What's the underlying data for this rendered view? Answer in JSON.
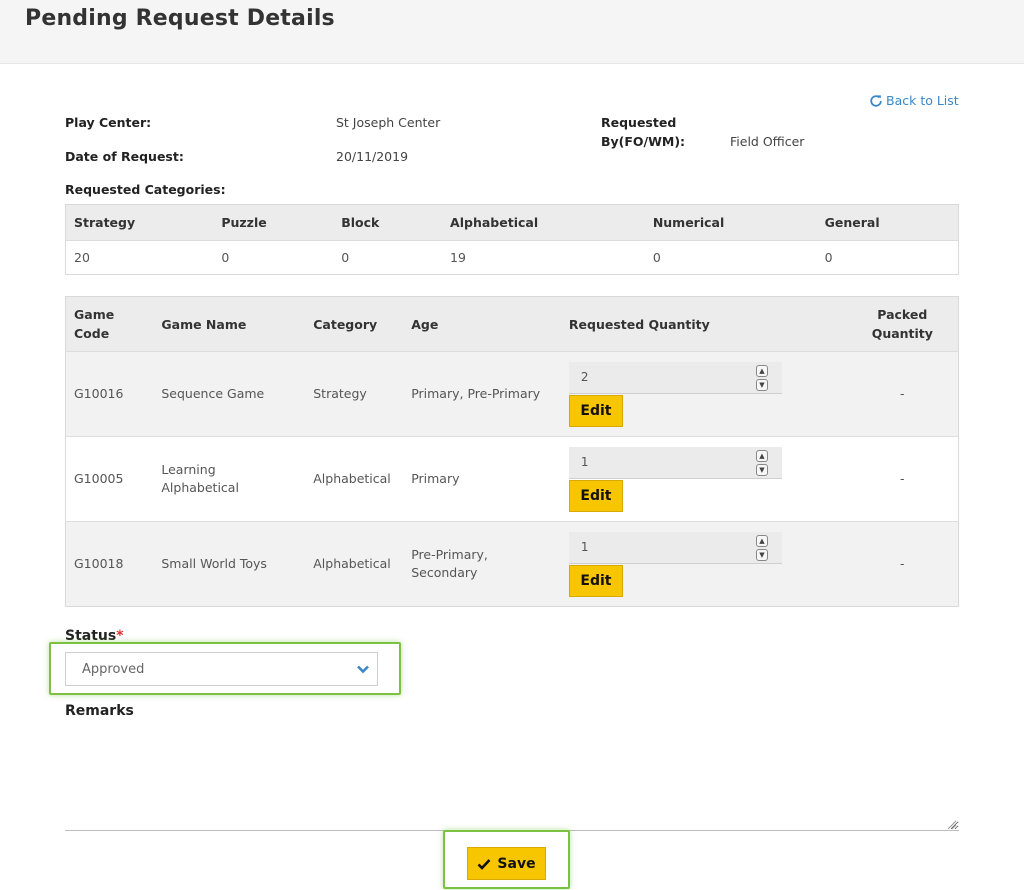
{
  "page": {
    "title": "Pending Request Details"
  },
  "back_link": {
    "label": "Back to List",
    "icon": "refresh-icon"
  },
  "info": {
    "play_center_label": "Play Center:",
    "play_center_value": "St Joseph Center",
    "date_label": "Date of Request:",
    "date_value": "20/11/2019",
    "requested_by_label_1": "Requested",
    "requested_by_label_2": "By(FO/WM):",
    "requested_by_value": "Field Officer",
    "categories_label": "Requested Categories:"
  },
  "categories_table": {
    "headers": [
      "Strategy",
      "Puzzle",
      "Block",
      "Alphabetical",
      "Numerical",
      "General"
    ],
    "values": [
      "20",
      "0",
      "0",
      "19",
      "0",
      "0"
    ]
  },
  "games_table": {
    "headers": {
      "code_1": "Game",
      "code_2": "Code",
      "name": "Game Name",
      "category": "Category",
      "age": "Age",
      "requested": "Requested Quantity",
      "packed_1": "Packed",
      "packed_2": "Quantity"
    },
    "rows": [
      {
        "code": "G10016",
        "name": "Sequence Game",
        "category": "Strategy",
        "age": "Primary, Pre-Primary",
        "qty": "2",
        "edit": "Edit",
        "packed": "-"
      },
      {
        "code": "G10005",
        "name": "Learning Alphabetical",
        "category": "Alphabetical",
        "age": "Primary",
        "qty": "1",
        "edit": "Edit",
        "packed": "-"
      },
      {
        "code": "G10018",
        "name": "Small World Toys",
        "category": "Alphabetical",
        "age": "Pre-Primary, Secondary",
        "qty": "1",
        "edit": "Edit",
        "packed": "-"
      }
    ]
  },
  "status": {
    "label": "Status",
    "required_mark": "*",
    "selected": "Approved"
  },
  "remarks": {
    "label": "Remarks",
    "value": ""
  },
  "save": {
    "label": "Save",
    "icon": "check-icon"
  },
  "colors": {
    "accent_button": "#f7c600",
    "link": "#3a87c8",
    "highlight": "#7cc242",
    "required": "#e03030"
  }
}
